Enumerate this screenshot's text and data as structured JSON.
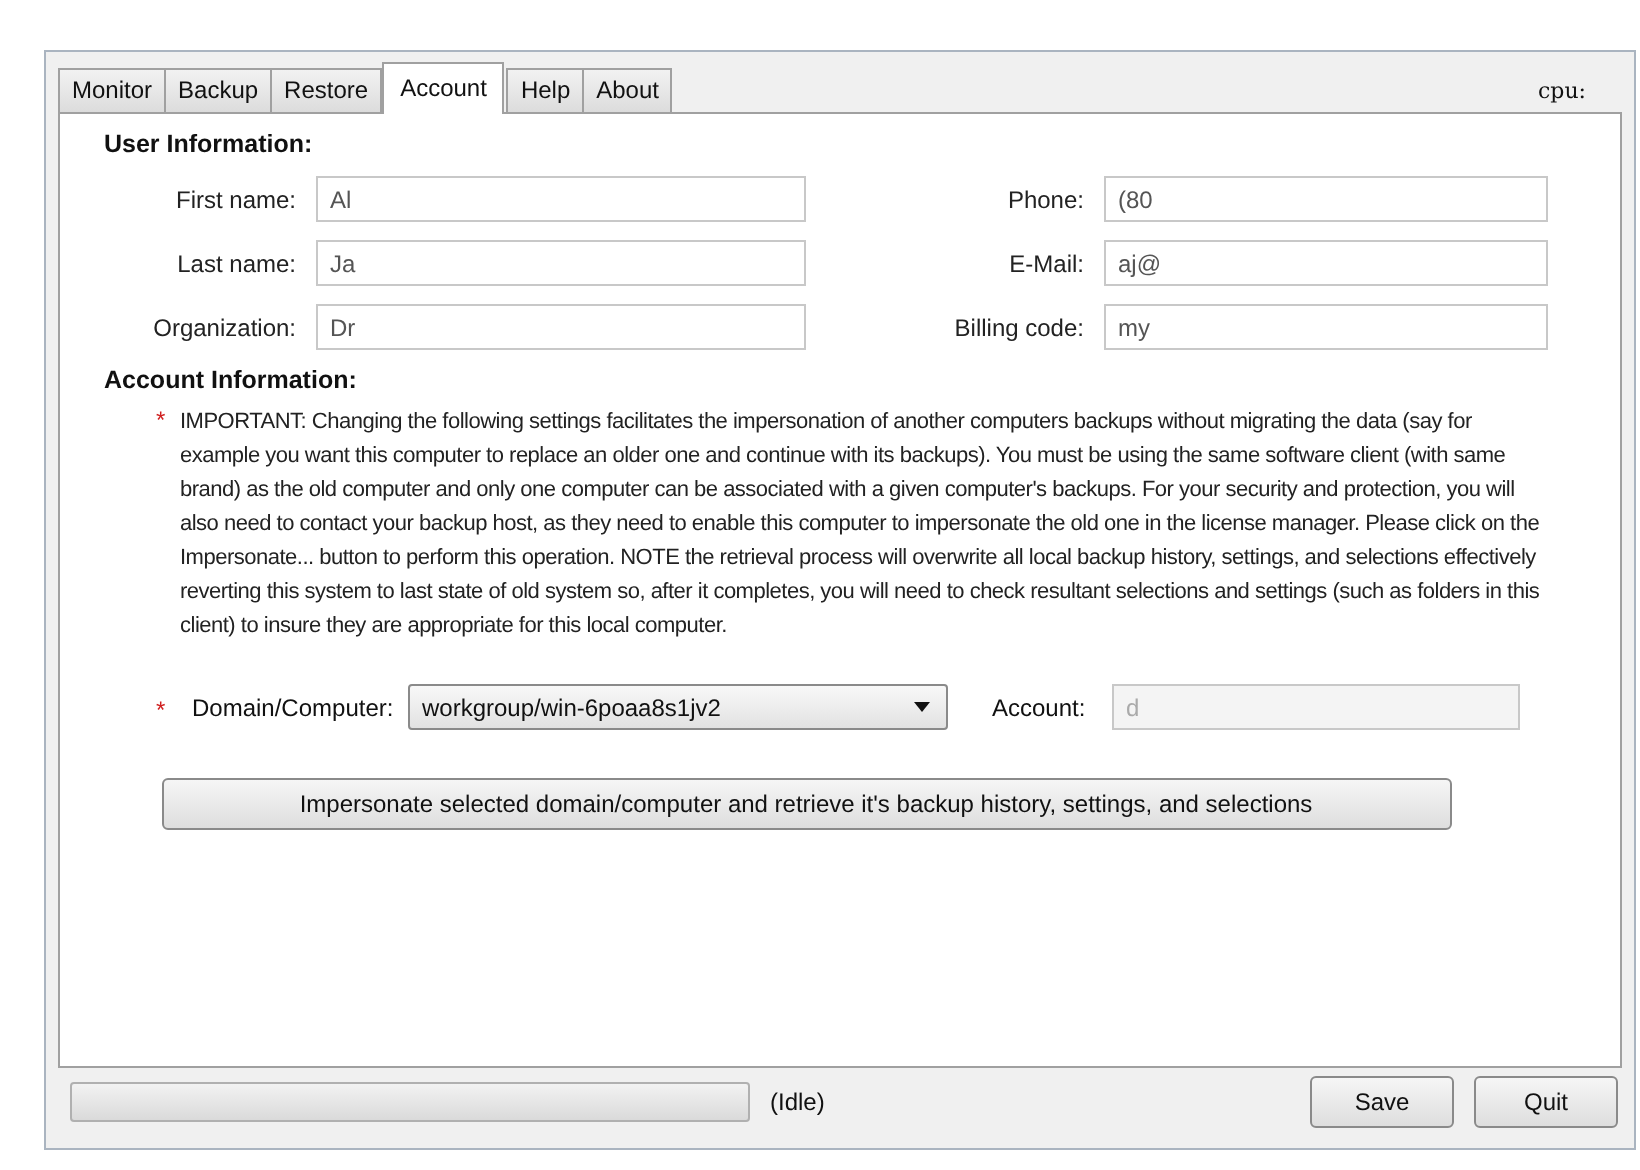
{
  "tabs": [
    {
      "label": "Monitor",
      "selected": false
    },
    {
      "label": "Backup",
      "selected": false
    },
    {
      "label": "Restore",
      "selected": false
    },
    {
      "label": "Account",
      "selected": true
    },
    {
      "label": "Help",
      "selected": false
    },
    {
      "label": "About",
      "selected": false
    }
  ],
  "cpu_label": "cpu:",
  "user_information": {
    "heading": "User Information:",
    "left_fields": [
      {
        "label": "First name:",
        "value": "Al"
      },
      {
        "label": "Last name:",
        "value": "Ja"
      },
      {
        "label": "Organization:",
        "value": "Dr"
      }
    ],
    "right_fields": [
      {
        "label": "Phone:",
        "value": "(80"
      },
      {
        "label": "E-Mail:",
        "value": "aj@"
      },
      {
        "label": "Billing code:",
        "value": "my"
      }
    ]
  },
  "account_information": {
    "heading": "Account Information:",
    "required_mark": "*",
    "notice": "IMPORTANT: Changing the following settings facilitates the impersonation of another computers backups without migrating the data (say for example you want this computer to replace an older one and continue with its backups).  You must be using the same software client (with same brand) as the old computer and only one computer can be associated with a given computer's backups.  For your security and protection, you will also need to contact your backup host, as they need to enable this computer to impersonate the old one in the license manager.  Please click on the Impersonate... button to perform this  operation.  NOTE the retrieval process will overwrite all local backup history, settings, and selections effectively reverting this system to last state of old system so, after it completes, you will need to check resultant selections and settings (such as folders in this client) to insure they are appropriate for this local computer.",
    "domain": {
      "required_mark": "*",
      "label": "Domain/Computer:",
      "value": "workgroup/win-6poaa8s1jv2"
    },
    "account": {
      "label": "Account:",
      "value": "d",
      "disabled": true
    },
    "impersonate_button": "Impersonate selected domain/computer and retrieve it's  backup history, settings, and selections"
  },
  "status_bar": {
    "progress": {
      "level": 0
    },
    "status": "(Idle)",
    "buttons": [
      "Save",
      "Quit"
    ]
  }
}
